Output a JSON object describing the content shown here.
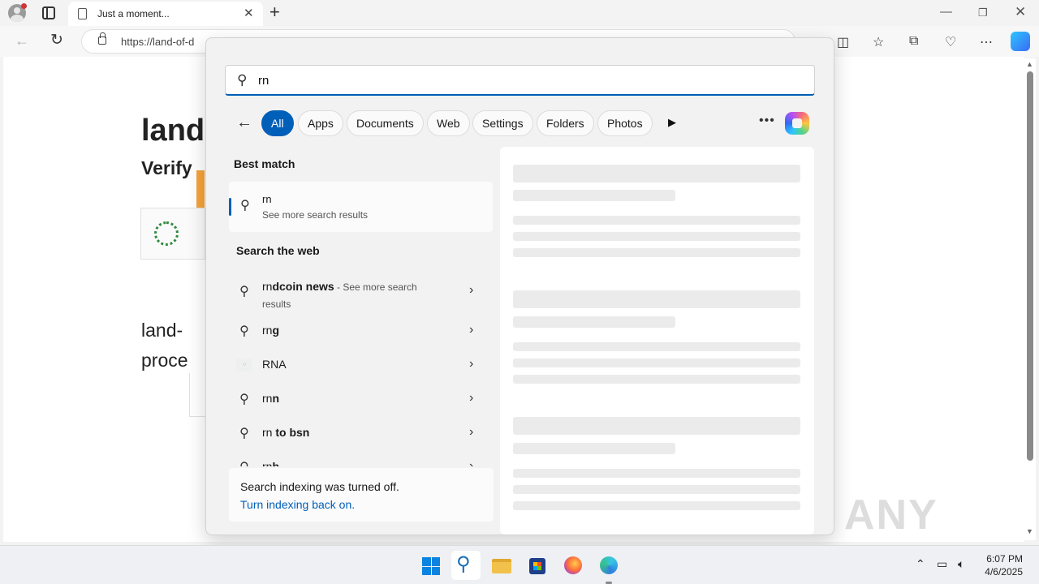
{
  "browser": {
    "tab_title": "Just a moment...",
    "url_visible": "https://land-of-d",
    "colors": {
      "accent": "#005fb8"
    }
  },
  "webpage": {
    "title": "land",
    "subtitle": "Verify",
    "paragraph_line1": "land-",
    "paragraph_line2": "proce"
  },
  "search": {
    "query": "rn",
    "filters": [
      "All",
      "Apps",
      "Documents",
      "Web",
      "Settings",
      "Folders",
      "Photos"
    ],
    "active_filter": "All",
    "best_match_heading": "Best match",
    "best_match": {
      "title": "rn",
      "subtitle": "See more search results"
    },
    "web_heading": "Search the web",
    "web_results": [
      {
        "typed": "rn",
        "rest": "dcoin news",
        "suffix": " - See more search",
        "suffix2": "results"
      },
      {
        "typed": "rn",
        "rest": "g"
      },
      {
        "label": "RNA"
      },
      {
        "typed": "rn",
        "rest": "n"
      },
      {
        "typed": "rn",
        "rest": " to bsn"
      },
      {
        "typed": "rn",
        "rest": "b"
      }
    ],
    "indexing_message": "Search indexing was turned off.",
    "indexing_link": "Turn indexing back on."
  },
  "watermark": "ANY RUN",
  "taskbar": {
    "time": "6:07 PM",
    "date": "4/6/2025",
    "apps": [
      "start",
      "search",
      "file-explorer",
      "microsoft-store",
      "firefox",
      "edge"
    ]
  }
}
